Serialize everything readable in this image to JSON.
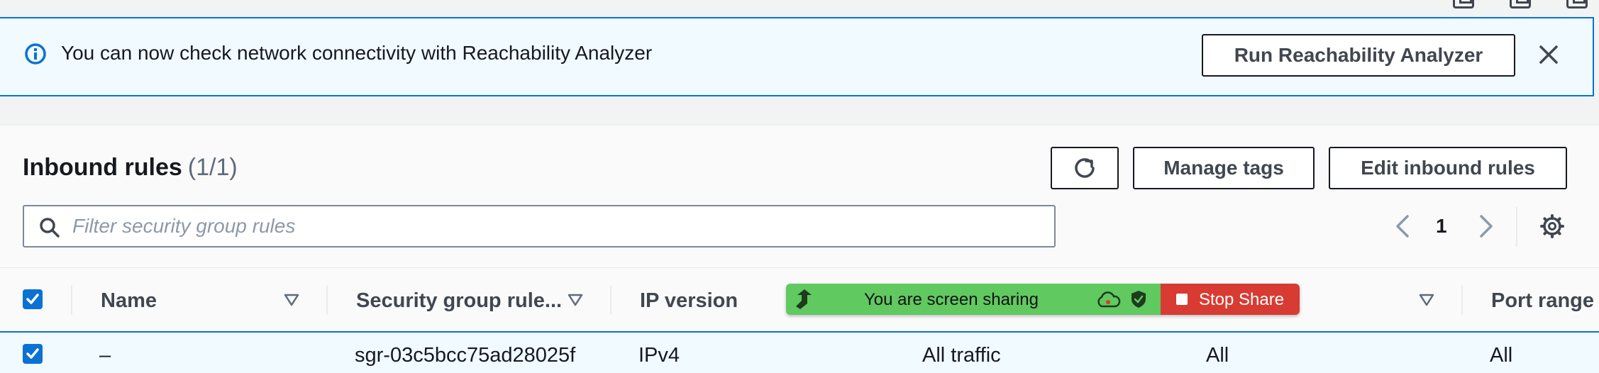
{
  "banner": {
    "message": "You can now check network connectivity with Reachability Analyzer",
    "button_label": "Run Reachability Analyzer"
  },
  "section": {
    "title": "Inbound rules",
    "count": "(1/1)",
    "refresh_icon": "refresh-icon",
    "manage_tags_label": "Manage tags",
    "edit_label": "Edit inbound rules"
  },
  "search": {
    "placeholder": "Filter security group rules",
    "icon": "search-icon"
  },
  "pagination": {
    "current_page": "1"
  },
  "table": {
    "columns": [
      {
        "label": "Name"
      },
      {
        "label": "Security group rule..."
      },
      {
        "label": "IP version"
      },
      {
        "label": ""
      },
      {
        "label": ""
      },
      {
        "label": "Port range"
      }
    ],
    "rows": [
      {
        "selected": true,
        "name": "–",
        "rule_id": "sgr-03c5bcc75ad28025f",
        "ip_version": "IPv4",
        "type": "All traffic",
        "protocol": "All",
        "port_range": "All"
      }
    ]
  },
  "screen_share": {
    "status_text": "You are screen sharing",
    "stop_label": "Stop Share",
    "colors": {
      "green": "#60c960",
      "red": "#d83b32"
    }
  },
  "colors": {
    "accent": "#0972d3",
    "banner_bg": "#f1faff",
    "text": "#16191f"
  }
}
